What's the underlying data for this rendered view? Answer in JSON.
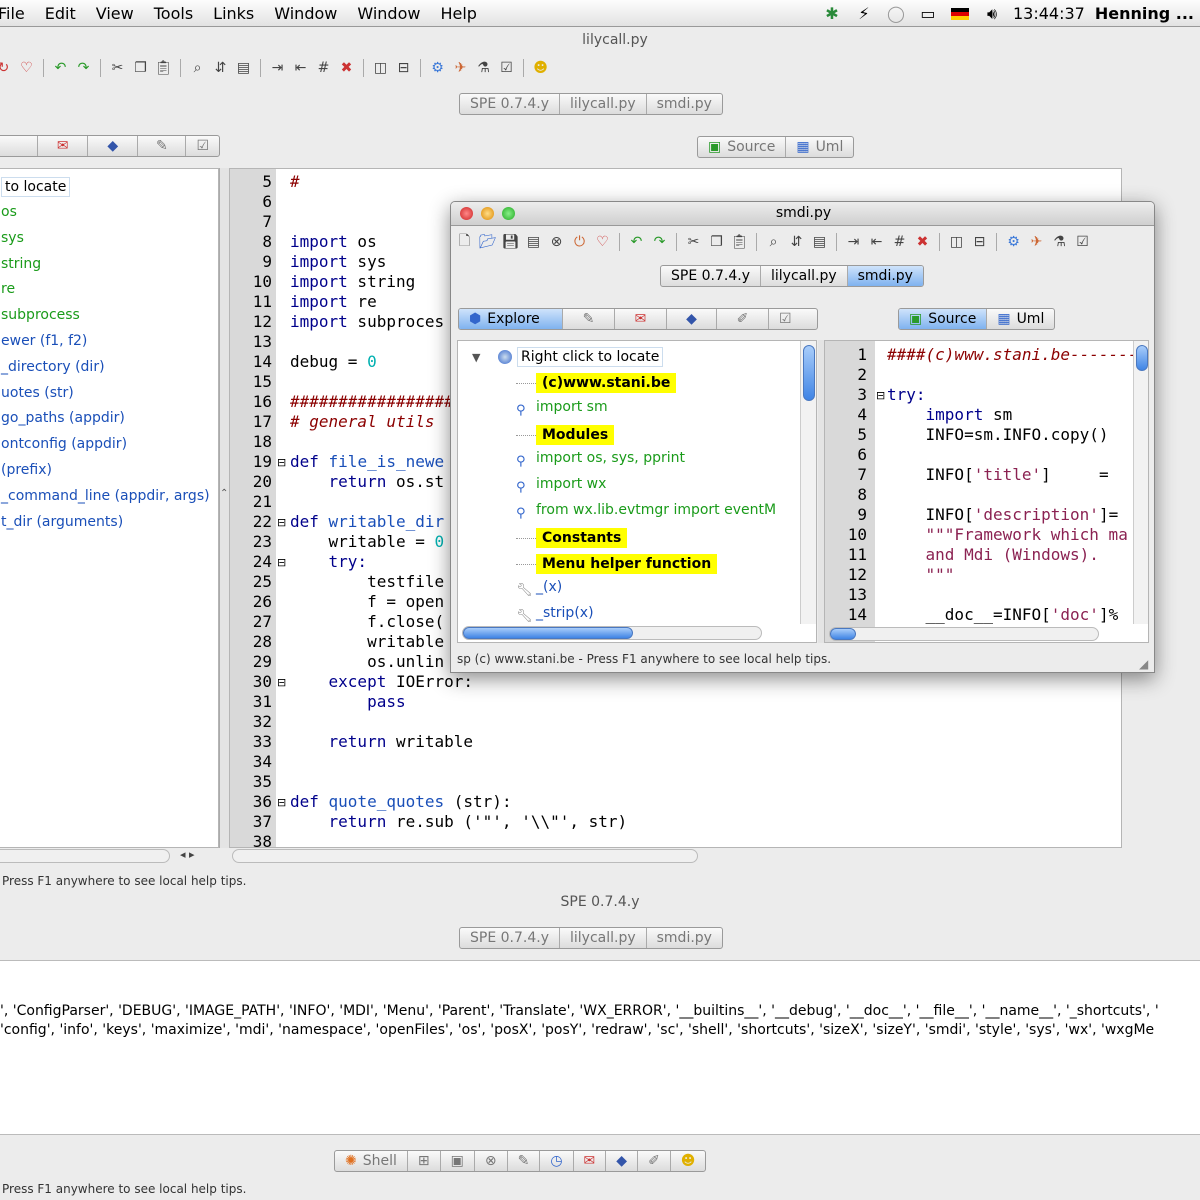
{
  "menubar": {
    "items": [
      "File",
      "Edit",
      "View",
      "Tools",
      "Links",
      "Window",
      "Window",
      "Help"
    ],
    "clock": "13:44:37",
    "user": "Henning ..."
  },
  "main_window": {
    "title": "lilycall.py",
    "tabs": [
      "SPE 0.7.4.y",
      "lilycall.py",
      "smdi.py"
    ],
    "source_tabs": [
      "Source",
      "Uml"
    ],
    "tree": [
      "to locate",
      "os",
      "sys",
      "string",
      "re",
      "subprocess",
      "ewer (f1, f2)",
      "_directory (dir)",
      "uotes (str)",
      "go_paths (appdir)",
      "ontconfig (appdir)",
      "(prefix)",
      "_command_line (appdir, args)",
      "t_dir (arguments)"
    ],
    "line_numbers": [
      "5",
      "6",
      "7",
      "8",
      "9",
      "10",
      "11",
      "12",
      "13",
      "14",
      "15",
      "16",
      "17",
      "18",
      "19",
      "20",
      "21",
      "22",
      "23",
      "24",
      "25",
      "26",
      "27",
      "28",
      "29",
      "30",
      "31",
      "32",
      "33",
      "34",
      "35",
      "36",
      "37",
      "38"
    ],
    "code": {
      "l5": "#",
      "l8a": "import",
      "l8b": " os",
      "l9a": "import",
      "l9b": " sys",
      "l10a": "import",
      "l10b": " string",
      "l11a": "import",
      "l11b": " re",
      "l12a": "import",
      "l12b": " subproces",
      "l14a": "debug = ",
      "l14b": "0",
      "l16": "##################",
      "l17": "# general utils",
      "l19a": "def",
      "l19b": " file_is_newe",
      "l20a": "    return",
      "l20b": " os.st",
      "l22a": "def",
      "l22b": " writable_dir",
      "l23a": "    writable = ",
      "l23b": "0",
      "l24": "    try:",
      "l25": "        testfile",
      "l26": "        f = open",
      "l27": "        f.close(",
      "l28": "        writable",
      "l29": "        os.unlin",
      "l30a": "    except",
      "l30b": " IOError:",
      "l31": "        pass",
      "l33a": "    return",
      "l33b": " writable",
      "l36a": "def",
      "l36b": " quote_quotes",
      "l36c": " (str):",
      "l37a": "    return",
      "l37b": " re.sub ('\"', '\\\\\"', str)"
    },
    "status": "Press F1 anywhere to see local help tips."
  },
  "smdi_window": {
    "title": "smdi.py",
    "tabs": [
      "SPE 0.7.4.y",
      "lilycall.py",
      "smdi.py"
    ],
    "explore_tab": "Explore",
    "source_tabs": [
      "Source",
      "Uml"
    ],
    "tree": {
      "root": "Right click to locate",
      "items": [
        {
          "text": "(c)www.stani.be",
          "style": "hl"
        },
        {
          "text": "import sm",
          "style": "green"
        },
        {
          "text": "Modules",
          "style": "hl"
        },
        {
          "text": "import  os, sys, pprint",
          "style": "green"
        },
        {
          "text": "import  wx",
          "style": "green"
        },
        {
          "text": "from    wx.lib.evtmgr import eventM",
          "style": "green"
        },
        {
          "text": "Constants",
          "style": "hl"
        },
        {
          "text": "Menu helper function",
          "style": "hl"
        },
        {
          "text": "_(x)",
          "style": "blue"
        },
        {
          "text": "_strip(x)",
          "style": "blue"
        }
      ]
    },
    "line_numbers": [
      "1",
      "2",
      "3",
      "4",
      "5",
      "6",
      "7",
      "8",
      "9",
      "10",
      "11",
      "12",
      "13",
      "14"
    ],
    "code": {
      "l1": "####(c)www.stani.be-------",
      "l3": "try:",
      "l4a": "    import",
      "l4b": " sm",
      "l5": "    INFO=sm.INFO.copy()",
      "l7a": "    INFO[",
      "l7b": "'title'",
      "l7c": "]     = ",
      "l9a": "    INFO[",
      "l9b": "'description'",
      "l9c": "]=",
      "l10": "    \"\"\"Framework which ma",
      "l11": "    and Mdi (Windows).",
      "l12": "    \"\"\"",
      "l14a": "    __doc__=INFO[",
      "l14b": "'doc'",
      "l14c": "]%"
    },
    "status": "sp  (c) www.stani.be - Press F1 anywhere to see local help tips."
  },
  "shell_window": {
    "title": "SPE 0.7.4.y",
    "tabs": [
      "SPE 0.7.4.y",
      "lilycall.py",
      "smdi.py"
    ],
    "output_line1": "', 'ConfigParser', 'DEBUG', 'IMAGE_PATH', 'INFO', 'MDI', 'Menu', 'Parent', 'Translate', 'WX_ERROR', '__builtins__', '__debug', '__doc__', '__file__', '__name__', '_shortcuts', '",
    "output_line2": "'config', 'info', 'keys', 'maximize', 'mdi', 'namespace', 'openFiles', 'os', 'posX', 'posY', 'redraw', 'sc', 'shell', 'shortcuts', 'sizeX', 'sizeY', 'smdi', 'style', 'sys', 'wx', 'wxgMe",
    "shell_tab": "Shell",
    "status": "Press F1 anywhere to see local help tips."
  }
}
